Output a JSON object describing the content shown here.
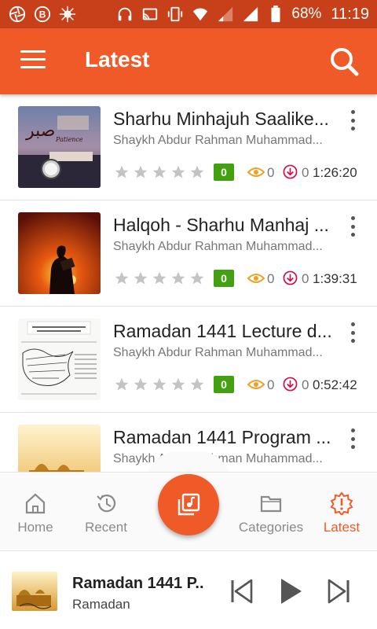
{
  "status_bar": {
    "battery": "68%",
    "time": "11:19"
  },
  "app_bar": {
    "title": "Latest",
    "menu_icon": "hamburger-menu-icon",
    "search_icon": "search-icon"
  },
  "items": [
    {
      "title": "Sharhu Minhajuh Saalike...",
      "subtitle": "Shaykh Abdur Rahman Muhammad...",
      "rating": 0,
      "rating_max": 5,
      "rating_badge": "0",
      "views": "0",
      "downloads": "0",
      "duration": "1:26:20",
      "thumb_caption": "Patience"
    },
    {
      "title": "Halqoh - Sharhu Manhaj ...",
      "subtitle": "Shaykh Abdur Rahman Muhammad...",
      "rating": 0,
      "rating_max": 5,
      "rating_badge": "0",
      "views": "0",
      "downloads": "0",
      "duration": "1:39:31"
    },
    {
      "title": "Ramadan 1441 Lecture d...",
      "subtitle": "Shaykh Abdur Rahman Muhammad...",
      "rating": 0,
      "rating_max": 5,
      "rating_badge": "0",
      "views": "0",
      "downloads": "0",
      "duration": "0:52:42"
    },
    {
      "title": "Ramadan 1441 Program ...",
      "subtitle": "Shaykh Abdur Rahman Muhammad..."
    }
  ],
  "bottom_nav": {
    "home": "Home",
    "recent": "Recent",
    "categories": "Categories",
    "latest": "Latest",
    "active": "latest"
  },
  "player": {
    "title": "Ramadan 1441 P..",
    "subtitle": "Ramadan"
  },
  "colors": {
    "status_bar": "#c8401a",
    "accent": "#f05a28",
    "rating_badge": "#43a010",
    "views_icon": "#f0a020",
    "download_icon": "#d0104a"
  }
}
